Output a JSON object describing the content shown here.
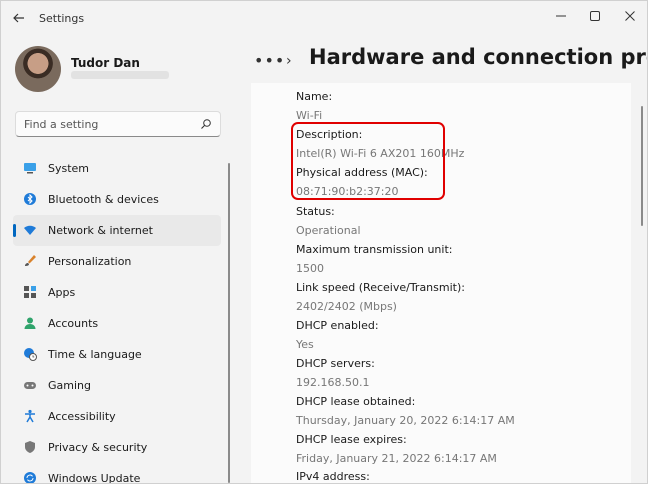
{
  "window": {
    "title": "Settings"
  },
  "user": {
    "name": "Tudor Dan"
  },
  "search": {
    "placeholder": "Find a setting"
  },
  "nav": {
    "items": [
      {
        "label": "System",
        "icon": "monitor-icon",
        "active": false
      },
      {
        "label": "Bluetooth & devices",
        "icon": "bluetooth-icon",
        "active": false
      },
      {
        "label": "Network & internet",
        "icon": "wifi-icon",
        "active": true
      },
      {
        "label": "Personalization",
        "icon": "brush-icon",
        "active": false
      },
      {
        "label": "Apps",
        "icon": "apps-icon",
        "active": false
      },
      {
        "label": "Accounts",
        "icon": "person-icon",
        "active": false
      },
      {
        "label": "Time & language",
        "icon": "globe-clock-icon",
        "active": false
      },
      {
        "label": "Gaming",
        "icon": "gamepad-icon",
        "active": false
      },
      {
        "label": "Accessibility",
        "icon": "accessibility-icon",
        "active": false
      },
      {
        "label": "Privacy & security",
        "icon": "shield-icon",
        "active": false
      },
      {
        "label": "Windows Update",
        "icon": "update-icon",
        "active": false
      }
    ]
  },
  "header": {
    "dots": "•••",
    "title": "Hardware and connection propertic"
  },
  "properties": [
    {
      "label": "Name:",
      "value": "Wi-Fi"
    },
    {
      "label": "Description:",
      "value": "Intel(R) Wi-Fi 6 AX201 160MHz"
    },
    {
      "label": "Physical address (MAC):",
      "value": "08:71:90:b2:37:20"
    },
    {
      "label": "Status:",
      "value": "Operational"
    },
    {
      "label": "Maximum transmission unit:",
      "value": "1500"
    },
    {
      "label": "Link speed (Receive/Transmit):",
      "value": "2402/2402 (Mbps)"
    },
    {
      "label": "DHCP enabled:",
      "value": "Yes"
    },
    {
      "label": "DHCP servers:",
      "value": "192.168.50.1"
    },
    {
      "label": "DHCP lease obtained:",
      "value": "Thursday, January 20, 2022 6:14:17 AM"
    },
    {
      "label": "DHCP lease expires:",
      "value": "Friday, January 21, 2022 6:14:17 AM"
    },
    {
      "label": "IPv4 address:",
      "value": ""
    }
  ],
  "colors": {
    "accent": "#0067c0",
    "highlight": "#e00000"
  }
}
